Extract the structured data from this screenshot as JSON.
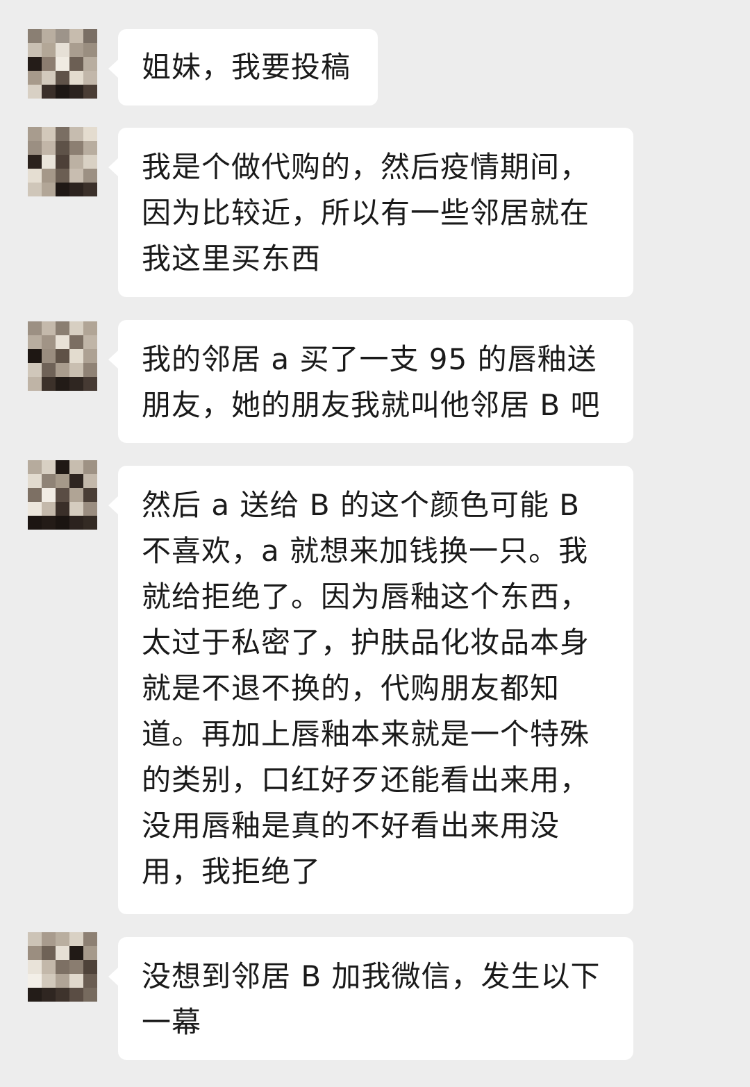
{
  "messages": [
    {
      "text": "姐妹，我要投稿"
    },
    {
      "text": "我是个做代购的，然后疫情期间，因为比较近，所以有一些邻居就在我这里买东西"
    },
    {
      "text": "我的邻居 a 买了一支 95 的唇釉送朋友，她的朋友我就叫他邻居 B 吧"
    },
    {
      "text": "然后 a 送给 B 的这个颜色可能 B 不喜欢，a 就想来加钱换一只。我就给拒绝了。因为唇釉这个东西，太过于私密了，护肤品化妆品本身就是不退不换的，代购朋友都知道。再加上唇釉本来就是一个特殊的类别，口红好歹还能看出来用，没用唇釉是真的不好看出来用没用，我拒绝了"
    },
    {
      "text": "没想到邻居 B 加我微信，发生以下一幕"
    }
  ],
  "avatar_icon": "pixelated-avatar-icon"
}
